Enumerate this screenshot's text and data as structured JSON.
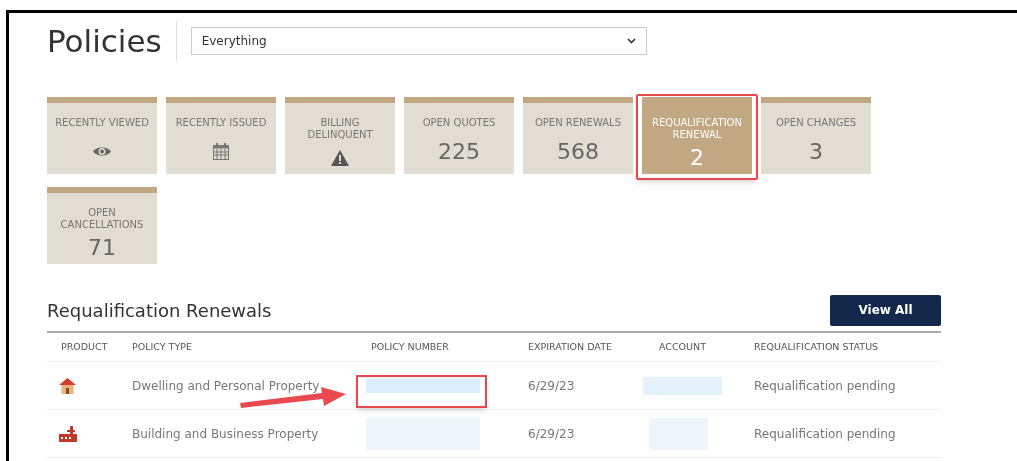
{
  "page_title": "Policies",
  "filter": {
    "value": "Everything"
  },
  "tiles": [
    {
      "label": "RECENTLY VIEWED",
      "kind": "eye",
      "selected": false
    },
    {
      "label": "RECENTLY ISSUED",
      "kind": "calendar",
      "selected": false
    },
    {
      "label": "BILLING DELINQUENT",
      "kind": "warning",
      "selected": false
    },
    {
      "label": "OPEN QUOTES",
      "kind": "count",
      "count": "225",
      "selected": false
    },
    {
      "label": "OPEN RENEWALS",
      "kind": "count",
      "count": "568",
      "selected": false
    },
    {
      "label": "REQUALIFICATION RENEWAL",
      "kind": "count",
      "count": "2",
      "selected": true,
      "highlighted": true
    },
    {
      "label": "OPEN CHANGES",
      "kind": "count",
      "count": "3",
      "selected": false
    },
    {
      "label": "OPEN CANCELLATIONS",
      "kind": "count",
      "count": "71",
      "selected": false
    }
  ],
  "section": {
    "title": "Requalification Renewals",
    "button": "View All"
  },
  "table": {
    "columns": [
      "PRODUCT",
      "POLICY TYPE",
      "POLICY NUMBER",
      "EXPIRATION DATE",
      "ACCOUNT",
      "REQUALIFICATION STATUS"
    ],
    "rows": [
      {
        "kind": "house",
        "policy_type": "Dwelling and Personal Property",
        "policy_number_highlighted": true,
        "expiration_date": "6/29/23",
        "status": "Requalification pending"
      },
      {
        "kind": "factory",
        "policy_type": "Building and Business Property",
        "policy_number_highlighted": false,
        "expiration_date": "6/29/23",
        "status": "Requalification pending"
      }
    ]
  }
}
